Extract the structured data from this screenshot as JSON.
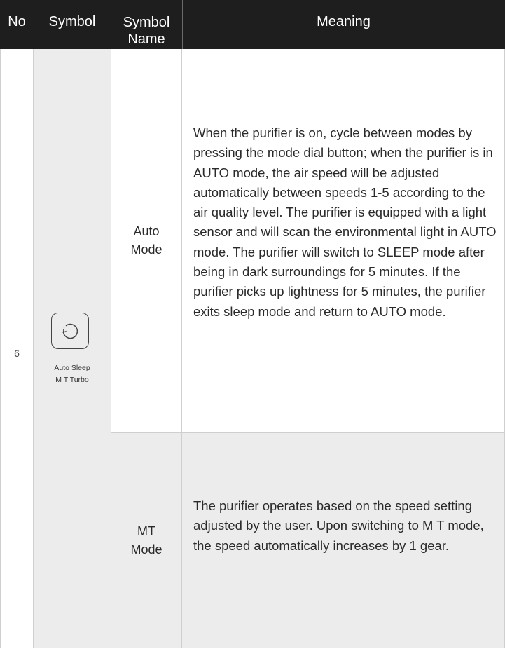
{
  "header": {
    "col_no": "No",
    "col_symbol": "Symbol",
    "col_name_line1": "Symbol",
    "col_name_line2": "Name",
    "col_meaning": "Meaning"
  },
  "row": {
    "no": "6",
    "symbol": {
      "icon": "circular-arrow-icon",
      "labels_line1": "Auto  Sleep",
      "labels_line2": "M T   Turbo"
    },
    "modes": [
      {
        "name_line1": "Auto",
        "name_line2": "Mode",
        "meaning": "When the purifier is on, cycle between modes by pressing the mode dial button; when the purifier is in AUTO mode, the air speed will be adjusted automatically between speeds 1-5 according to the air quality level. The purifier is equipped with a light sensor and will scan the environmental light in AUTO mode. The purifier will switch to SLEEP mode after being in dark surroundings for 5 minutes. If the purifier picks up lightness for 5 minutes, the purifier exits sleep mode and return to AUTO mode."
      },
      {
        "name_line1": "MT",
        "name_line2": "Mode",
        "meaning": "The purifier operates based on the speed setting adjusted by the user. Upon switching to M T mode, the speed automatically increases by 1 gear."
      }
    ]
  },
  "colors": {
    "header_bg": "#1e1e1e",
    "shaded_cell": "#ececec",
    "border": "#cfcfcf"
  }
}
